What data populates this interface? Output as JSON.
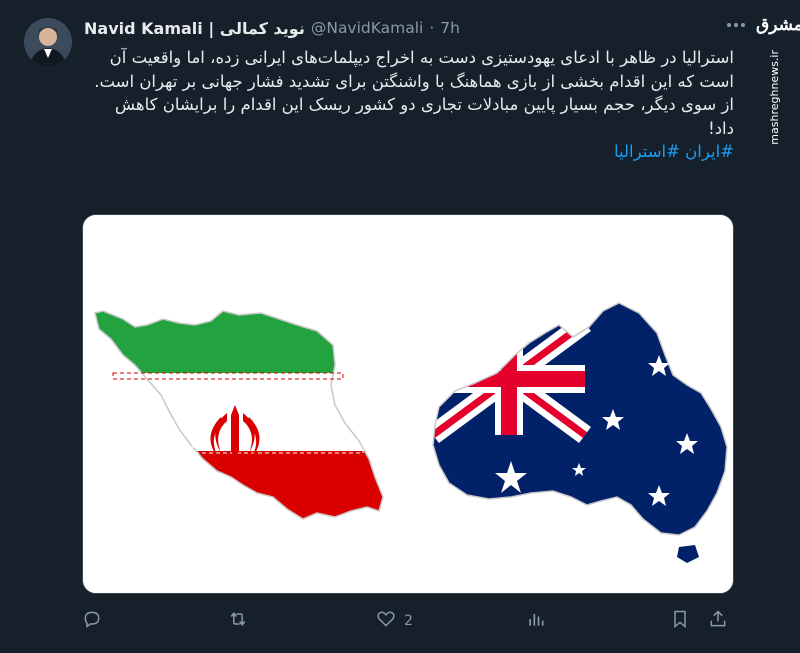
{
  "tweet": {
    "display_name": "Navid Kamali | نوید کمالی",
    "handle": "@NavidKamali",
    "separator": "·",
    "time": "7h",
    "paragraph_1": "استرالیا در ظاهر با ادعای یهودستیزی دست به اخراج دیپلمات‌های ایرانی زده، اما واقعیت آن است که این اقدام بخشی از بازی هماهنگ با واشنگتن برای تشدید فشار جهانی بر تهران است.",
    "paragraph_2": "از سوی دیگر، حجم بسیار پایین مبادلات تجاری دو کشور ریسک این اقدام را برایشان کاهش داد!",
    "hashtags": "#ایران #استرالیا",
    "more_icon": "more-horizontal-icon"
  },
  "watermark": {
    "logo": "مشرق",
    "url": "mashreghnews.ir"
  },
  "media": {
    "description_icons": [
      "iran-flag-map",
      "australia-flag-map"
    ],
    "colors": {
      "iran_green": "#23a33f",
      "iran_red": "#da0000",
      "aus_blue": "#012169",
      "aus_red": "#e4002b"
    }
  },
  "actions": {
    "reply_icon": "reply-icon",
    "retweet_icon": "retweet-icon",
    "like_icon": "heart-icon",
    "like_count": "2",
    "views_icon": "views-icon",
    "bookmark_icon": "bookmark-icon",
    "share_icon": "share-icon"
  },
  "colors": {
    "background": "#15202b",
    "text": "#e7e9ea",
    "muted": "#8b98a5",
    "link": "#1d9bf0"
  }
}
